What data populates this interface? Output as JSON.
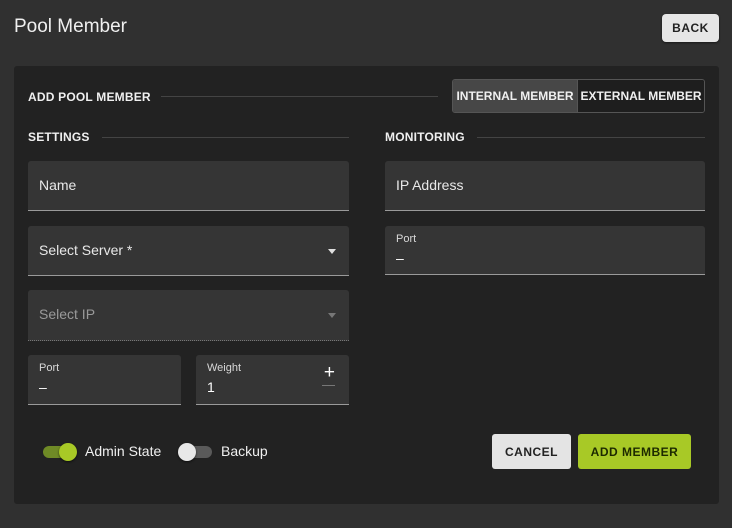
{
  "header": {
    "title": "Pool Member",
    "back_label": "BACK"
  },
  "card": {
    "title": "ADD POOL MEMBER",
    "member_type": {
      "options": [
        "INTERNAL MEMBER",
        "EXTERNAL MEMBER"
      ],
      "selected": "INTERNAL MEMBER"
    },
    "settings": {
      "heading": "SETTINGS",
      "name_placeholder": "Name",
      "server_placeholder": "Select Server *",
      "ip_placeholder": "Select IP",
      "port": {
        "label": "Port",
        "value": "–"
      },
      "weight": {
        "label": "Weight",
        "value": "1"
      }
    },
    "monitoring": {
      "heading": "MONITORING",
      "ip_placeholder": "IP Address",
      "port": {
        "label": "Port",
        "value": "–"
      }
    },
    "switches": {
      "admin_state": {
        "label": "Admin State",
        "on": true
      },
      "backup": {
        "label": "Backup",
        "on": false
      }
    },
    "actions": {
      "cancel_label": "CANCEL",
      "add_label": "ADD MEMBER"
    }
  },
  "colors": {
    "accent": "#a8c926",
    "switch_on_track": "#6f8a26",
    "switch_off_track": "#5a5a5a"
  }
}
